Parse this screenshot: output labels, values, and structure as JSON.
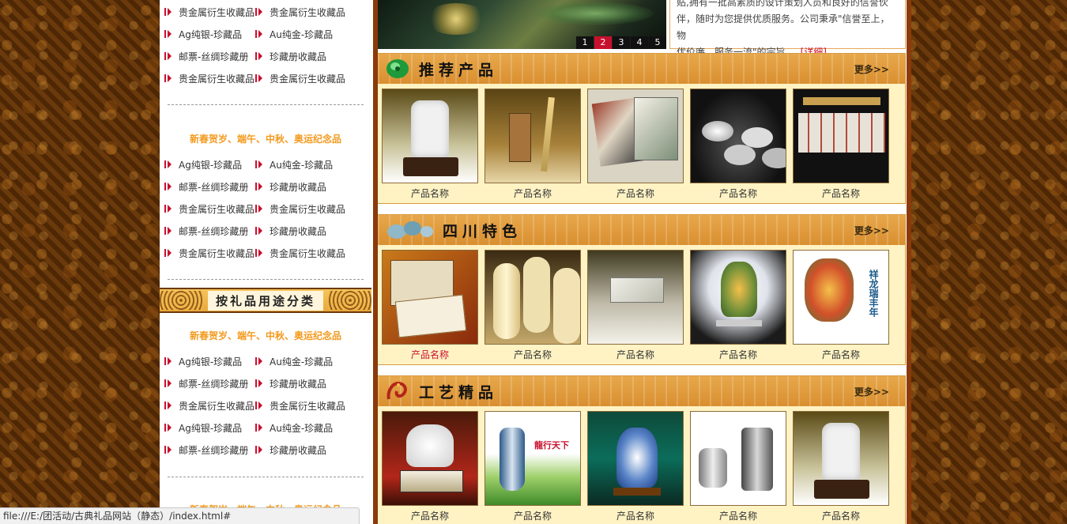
{
  "sidebar": {
    "rows_top": [
      [
        "贵金属衍生收藏品",
        "贵金属衍生收藏品"
      ],
      [
        "Ag纯银-珍藏品",
        "Au纯金-珍藏品"
      ],
      [
        "邮票-丝绸珍藏册",
        "珍藏册收藏品"
      ],
      [
        "贵金属衍生收藏品",
        "贵金属衍生收藏品"
      ]
    ],
    "group1_title": "新春贺岁、端午、中秋、奥运纪念品",
    "rows_g1": [
      [
        "Ag纯银-珍藏品",
        "Au纯金-珍藏品"
      ],
      [
        "邮票-丝绸珍藏册",
        "珍藏册收藏品"
      ],
      [
        "贵金属衍生收藏品",
        "贵金属衍生收藏品"
      ],
      [
        "邮票-丝绸珍藏册",
        "珍藏册收藏品"
      ],
      [
        "贵金属衍生收藏品",
        "贵金属衍生收藏品"
      ]
    ],
    "category_banner": "按礼品用途分类",
    "group2_title": "新春贺岁、端午、中秋、奥运纪念品",
    "rows_g2": [
      [
        "Ag纯银-珍藏品",
        "Au纯金-珍藏品"
      ],
      [
        "邮票-丝绸珍藏册",
        "珍藏册收藏品"
      ],
      [
        "贵金属衍生收藏品",
        "贵金属衍生收藏品"
      ],
      [
        "Ag纯银-珍藏品",
        "Au纯金-珍藏品"
      ],
      [
        "邮票-丝绸珍藏册",
        "珍藏册收藏品"
      ]
    ],
    "group3_title": "新春贺岁、端午、中秋、奥运纪念品"
  },
  "slider": {
    "pages": [
      "1",
      "2",
      "3",
      "4",
      "5"
    ],
    "active_page": "2"
  },
  "about": {
    "line1": "贴,拥有一批高素质的设计策划人员和良好的信誉伙",
    "line2": "伴，随时为您提供优质服务。公司秉承\"信誉至上，物",
    "line3": "优价廉，服务一流\"的宗旨.....",
    "detail_link": "[详细]"
  },
  "sections": [
    {
      "title": "推荐产品",
      "more": "更多>>",
      "products": [
        "产品名称",
        "产品名称",
        "产品名称",
        "产品名称",
        "产品名称"
      ]
    },
    {
      "title": "四川特色",
      "more": "更多>>",
      "products": [
        "产品名称",
        "产品名称",
        "产品名称",
        "产品名称",
        "产品名称"
      ]
    },
    {
      "title": "工艺精品",
      "more": "更多>>",
      "products": [
        "产品名称",
        "产品名称",
        "产品名称",
        "产品名称",
        "产品名称"
      ]
    }
  ],
  "thumb_text": {
    "dragon2": "祥龙瑞丰年",
    "vase": "龍行天下"
  },
  "statusbar": {
    "url": "file:///E:/团活动/古典礼品网站（静态）/index.html#"
  },
  "colors": {
    "accent_red": "#c8102e",
    "orange_title": "#f39a1e",
    "section_bg": "#fff3c4",
    "section_head": "#d98f30"
  }
}
